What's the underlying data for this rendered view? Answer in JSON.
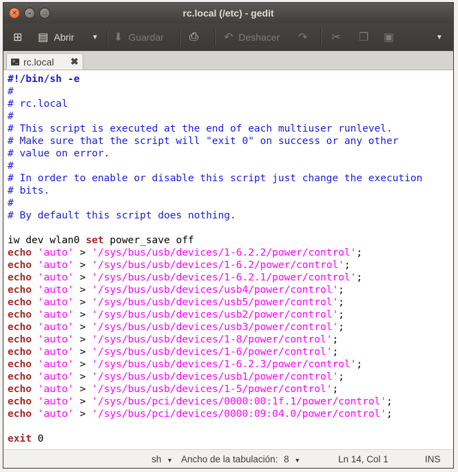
{
  "window": {
    "title": "rc.local (/etc) - gedit"
  },
  "toolbar": {
    "open_label": "Abrir",
    "save_label": "Guardar",
    "undo_label": "Deshacer"
  },
  "tab": {
    "label": "rc.local"
  },
  "code": [
    [
      {
        "t": "#!/bin/sh -e",
        "c": "sb"
      }
    ],
    [
      {
        "t": "#",
        "c": "c"
      }
    ],
    [
      {
        "t": "# rc.local",
        "c": "c"
      }
    ],
    [
      {
        "t": "#",
        "c": "c"
      }
    ],
    [
      {
        "t": "# This script is executed at the end of each multiuser runlevel.",
        "c": "c"
      }
    ],
    [
      {
        "t": "# Make sure that the script will \"exit 0\" on success or any other",
        "c": "c"
      }
    ],
    [
      {
        "t": "# value on error.",
        "c": "c"
      }
    ],
    [
      {
        "t": "#",
        "c": "c"
      }
    ],
    [
      {
        "t": "# In order to enable or disable this script just change the execution",
        "c": "c"
      }
    ],
    [
      {
        "t": "# bits.",
        "c": "c"
      }
    ],
    [
      {
        "t": "#",
        "c": "c"
      }
    ],
    [
      {
        "t": "# By default this script does nothing.",
        "c": "c"
      }
    ],
    [],
    [
      {
        "t": "iw dev wlan0 ",
        "c": "n"
      },
      {
        "t": "set",
        "c": "k"
      },
      {
        "t": " power_save off",
        "c": "n"
      }
    ],
    [
      {
        "t": "echo",
        "c": "k"
      },
      {
        "t": " ",
        "c": "n"
      },
      {
        "t": "'auto'",
        "c": "s"
      },
      {
        "t": " > ",
        "c": "n"
      },
      {
        "t": "'/sys/bus/usb/devices/1-6.2.2/power/control'",
        "c": "s"
      },
      {
        "t": ";",
        "c": "n"
      }
    ],
    [
      {
        "t": "echo",
        "c": "k"
      },
      {
        "t": " ",
        "c": "n"
      },
      {
        "t": "'auto'",
        "c": "s"
      },
      {
        "t": " > ",
        "c": "n"
      },
      {
        "t": "'/sys/bus/usb/devices/1-6.2/power/control'",
        "c": "s"
      },
      {
        "t": ";",
        "c": "n"
      }
    ],
    [
      {
        "t": "echo",
        "c": "k"
      },
      {
        "t": " ",
        "c": "n"
      },
      {
        "t": "'auto'",
        "c": "s"
      },
      {
        "t": " > ",
        "c": "n"
      },
      {
        "t": "'/sys/bus/usb/devices/1-6.2.1/power/control'",
        "c": "s"
      },
      {
        "t": ";",
        "c": "n"
      }
    ],
    [
      {
        "t": "echo",
        "c": "k"
      },
      {
        "t": " ",
        "c": "n"
      },
      {
        "t": "'auto'",
        "c": "s"
      },
      {
        "t": " > ",
        "c": "n"
      },
      {
        "t": "'/sys/bus/usb/devices/usb4/power/control'",
        "c": "s"
      },
      {
        "t": ";",
        "c": "n"
      }
    ],
    [
      {
        "t": "echo",
        "c": "k"
      },
      {
        "t": " ",
        "c": "n"
      },
      {
        "t": "'auto'",
        "c": "s"
      },
      {
        "t": " > ",
        "c": "n"
      },
      {
        "t": "'/sys/bus/usb/devices/usb5/power/control'",
        "c": "s"
      },
      {
        "t": ";",
        "c": "n"
      }
    ],
    [
      {
        "t": "echo",
        "c": "k"
      },
      {
        "t": " ",
        "c": "n"
      },
      {
        "t": "'auto'",
        "c": "s"
      },
      {
        "t": " > ",
        "c": "n"
      },
      {
        "t": "'/sys/bus/usb/devices/usb2/power/control'",
        "c": "s"
      },
      {
        "t": ";",
        "c": "n"
      }
    ],
    [
      {
        "t": "echo",
        "c": "k"
      },
      {
        "t": " ",
        "c": "n"
      },
      {
        "t": "'auto'",
        "c": "s"
      },
      {
        "t": " > ",
        "c": "n"
      },
      {
        "t": "'/sys/bus/usb/devices/usb3/power/control'",
        "c": "s"
      },
      {
        "t": ";",
        "c": "n"
      }
    ],
    [
      {
        "t": "echo",
        "c": "k"
      },
      {
        "t": " ",
        "c": "n"
      },
      {
        "t": "'auto'",
        "c": "s"
      },
      {
        "t": " > ",
        "c": "n"
      },
      {
        "t": "'/sys/bus/usb/devices/1-8/power/control'",
        "c": "s"
      },
      {
        "t": ";",
        "c": "n"
      }
    ],
    [
      {
        "t": "echo",
        "c": "k"
      },
      {
        "t": " ",
        "c": "n"
      },
      {
        "t": "'auto'",
        "c": "s"
      },
      {
        "t": " > ",
        "c": "n"
      },
      {
        "t": "'/sys/bus/usb/devices/1-6/power/control'",
        "c": "s"
      },
      {
        "t": ";",
        "c": "n"
      }
    ],
    [
      {
        "t": "echo",
        "c": "k"
      },
      {
        "t": " ",
        "c": "n"
      },
      {
        "t": "'auto'",
        "c": "s"
      },
      {
        "t": " > ",
        "c": "n"
      },
      {
        "t": "'/sys/bus/usb/devices/1-6.2.3/power/control'",
        "c": "s"
      },
      {
        "t": ";",
        "c": "n"
      }
    ],
    [
      {
        "t": "echo",
        "c": "k"
      },
      {
        "t": " ",
        "c": "n"
      },
      {
        "t": "'auto'",
        "c": "s"
      },
      {
        "t": " > ",
        "c": "n"
      },
      {
        "t": "'/sys/bus/usb/devices/usb1/power/control'",
        "c": "s"
      },
      {
        "t": ";",
        "c": "n"
      }
    ],
    [
      {
        "t": "echo",
        "c": "k"
      },
      {
        "t": " ",
        "c": "n"
      },
      {
        "t": "'auto'",
        "c": "s"
      },
      {
        "t": " > ",
        "c": "n"
      },
      {
        "t": "'/sys/bus/usb/devices/1-5/power/control'",
        "c": "s"
      },
      {
        "t": ";",
        "c": "n"
      }
    ],
    [
      {
        "t": "echo",
        "c": "k"
      },
      {
        "t": " ",
        "c": "n"
      },
      {
        "t": "'auto'",
        "c": "s"
      },
      {
        "t": " > ",
        "c": "n"
      },
      {
        "t": "'/sys/bus/pci/devices/0000:00:1f.1/power/control'",
        "c": "s"
      },
      {
        "t": ";",
        "c": "n"
      }
    ],
    [
      {
        "t": "echo",
        "c": "k"
      },
      {
        "t": " ",
        "c": "n"
      },
      {
        "t": "'auto'",
        "c": "s"
      },
      {
        "t": " > ",
        "c": "n"
      },
      {
        "t": "'/sys/bus/pci/devices/0000:09:04.0/power/control'",
        "c": "s"
      },
      {
        "t": ";",
        "c": "n"
      }
    ],
    [],
    [
      {
        "t": "exit",
        "c": "k"
      },
      {
        "t": " 0",
        "c": "n"
      }
    ]
  ],
  "status": {
    "language": "sh",
    "tab_width_label": "Ancho de la tabulación:",
    "tab_width_value": "8",
    "position": "Ln 14, Col 1",
    "mode": "INS"
  },
  "colors": {
    "comment": "#1a1ae0",
    "keyword": "#a52a2a",
    "string": "#ff00ff",
    "titlebar": "#403f3b"
  }
}
